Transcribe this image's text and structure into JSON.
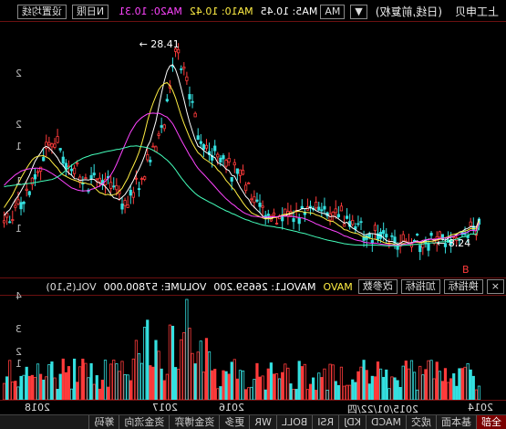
{
  "header": {
    "stock_name": "上工申贝",
    "period": "(日线,前复权)",
    "ma_chip": "MA",
    "ma5": "MA5: 10.45",
    "ma10": "MA10: 10.42",
    "ma20": "MA20: 10.31",
    "ma_more": "N日限",
    "settings": "设置均线",
    "ma_switch": "▼"
  },
  "annotations": {
    "high": "28.41",
    "low": "8.24",
    "flag": "B"
  },
  "main_axis": [
    "2",
    "2",
    "1",
    "1",
    "1"
  ],
  "volume_bar": {
    "indicator": "VOL(5,10)",
    "volume": "VOLUME: 57800.000",
    "mavol1": "MAVOL1: 26659.200",
    "mavol2": "MAVO",
    "change_param": "改参数",
    "add_indicator": "加指标",
    "switch_indicator": "换指标"
  },
  "vol_axis": [
    "4",
    "3",
    "2",
    "1"
  ],
  "dates": [
    "2018",
    "2017",
    "2016",
    "2015/01/22/四",
    "2014"
  ],
  "tabs": [
    "全部",
    "基本面",
    "成交",
    "MACD",
    "KDJ",
    "RSI",
    "BOLL",
    "WR",
    "更多",
    "资金博弈",
    "资金流向",
    "筹码"
  ],
  "active_tab": "全部",
  "colors": {
    "up": "#ff3b3b",
    "down": "#34e0e0",
    "ma5": "#ffffff",
    "ma10": "#ffee44",
    "ma20": "#ff44ff",
    "ma60": "#44ffbb"
  }
}
